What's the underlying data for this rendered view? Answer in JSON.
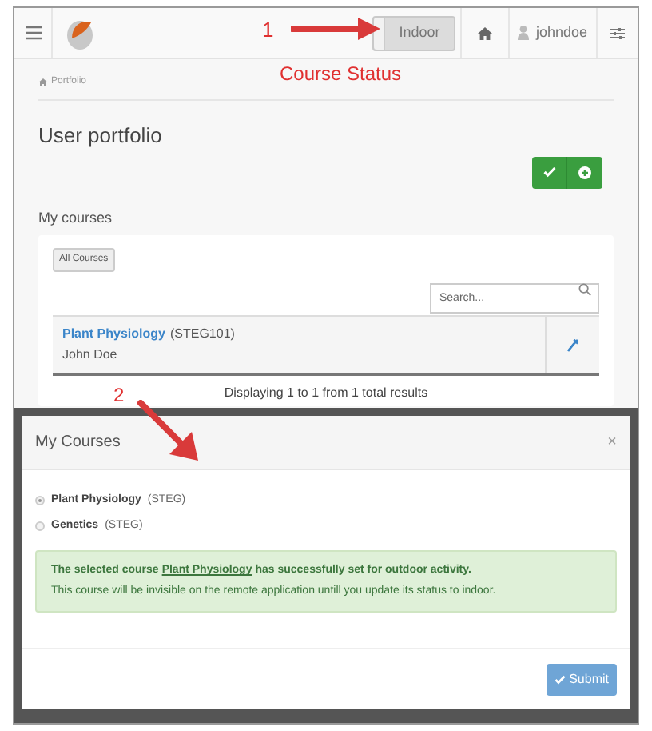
{
  "navbar": {
    "status_toggle": "Indoor",
    "user": "johndoe"
  },
  "annotations": [
    {
      "number": "1",
      "label": "Course Status"
    },
    {
      "number": "2"
    }
  ],
  "breadcrumb": "Portfolio",
  "page_title": "User portfolio",
  "section_title": "My courses",
  "filter_button": "All Courses",
  "search": {
    "placeholder": "Search..."
  },
  "courses": [
    {
      "title": "Plant Physiology",
      "code": "(STEG101)",
      "owner": "John Doe"
    }
  ],
  "pagination_info": "Displaying 1 to 1 from 1 total results",
  "modal": {
    "title": "My Courses",
    "close": "×",
    "options": [
      {
        "name": "Plant Physiology",
        "code": "(STEG)",
        "selected": true
      },
      {
        "name": "Genetics",
        "code": "(STEG)",
        "selected": false
      }
    ],
    "alert": {
      "before": "The selected course",
      "link": "Plant Physiology",
      "after": "has successfully set for outdoor activity.",
      "note": "This course will be invisible on the remote application untill you update its status to indoor."
    },
    "submit": "Submit"
  }
}
